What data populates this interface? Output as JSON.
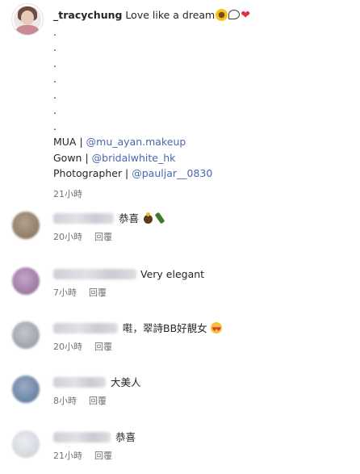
{
  "post": {
    "username": "_tracychung",
    "caption_text": "Love like a dream",
    "dots": [
      ".",
      ".",
      ".",
      ".",
      ".",
      ".",
      "."
    ],
    "credits": [
      {
        "label": "MUA | ",
        "handle": "@mu_ayan.makeup"
      },
      {
        "label": "Gown | ",
        "handle": "@bridalwhite_hk"
      },
      {
        "label": "Photographer | ",
        "handle": "@pauljar__0830"
      }
    ],
    "time": "21小時",
    "emojis": [
      "sunflower-emoji",
      "speech-bubble-emoji",
      "red-heart-emoji"
    ]
  },
  "comments": [
    {
      "name_blurred": true,
      "text": "恭喜",
      "time": "20小時",
      "reply": "回覆",
      "avatar_color": "#8a7a66",
      "emojis": [
        "party-emoji",
        "bottle-emoji"
      ]
    },
    {
      "name_blurred": true,
      "text": "Very elegant",
      "time": "7小時",
      "reply": "回覆",
      "avatar_color": "#9c7aa0",
      "emojis": []
    },
    {
      "name_blurred": true,
      "text": "嚡，翠詩BB好靚女",
      "time": "20小時",
      "reply": "回覆",
      "avatar_color": "#a3a7b0",
      "emojis": [
        "heart-eyes-emoji"
      ]
    },
    {
      "name_blurred": true,
      "text": "大美人",
      "time": "8小時",
      "reply": "回覆",
      "avatar_color": "#6f86a8",
      "emojis": []
    },
    {
      "name_blurred": true,
      "text": "恭喜",
      "time": "21小時",
      "reply": "回覆",
      "avatar_color": "#d8dbe2",
      "emojis": []
    }
  ],
  "heart_glyph": "❤"
}
